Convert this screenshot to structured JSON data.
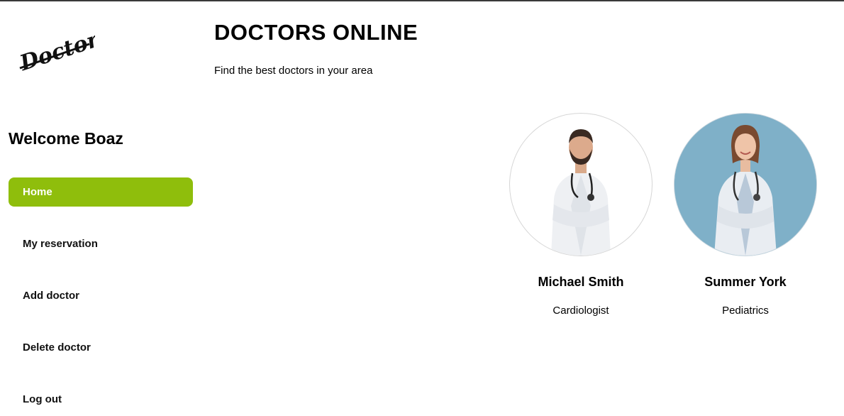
{
  "brand": {
    "logo_text": "Doctors"
  },
  "header": {
    "title": "DOCTORS ONLINE",
    "subtitle": "Find the best doctors in your area"
  },
  "sidebar": {
    "welcome": "Welcome Boaz",
    "items": [
      {
        "label": "Home",
        "active": true
      },
      {
        "label": "My reservation",
        "active": false
      },
      {
        "label": "Add doctor",
        "active": false
      },
      {
        "label": "Delete doctor",
        "active": false
      },
      {
        "label": "Log out",
        "active": false
      }
    ]
  },
  "doctors": [
    {
      "name": "Michael Smith",
      "specialty": "Cardiologist"
    },
    {
      "name": "Summer York",
      "specialty": "Pediatrics"
    }
  ],
  "colors": {
    "accent": "#8fbe0c",
    "text": "#000000",
    "photo2_bg": "#7fb0c8"
  }
}
